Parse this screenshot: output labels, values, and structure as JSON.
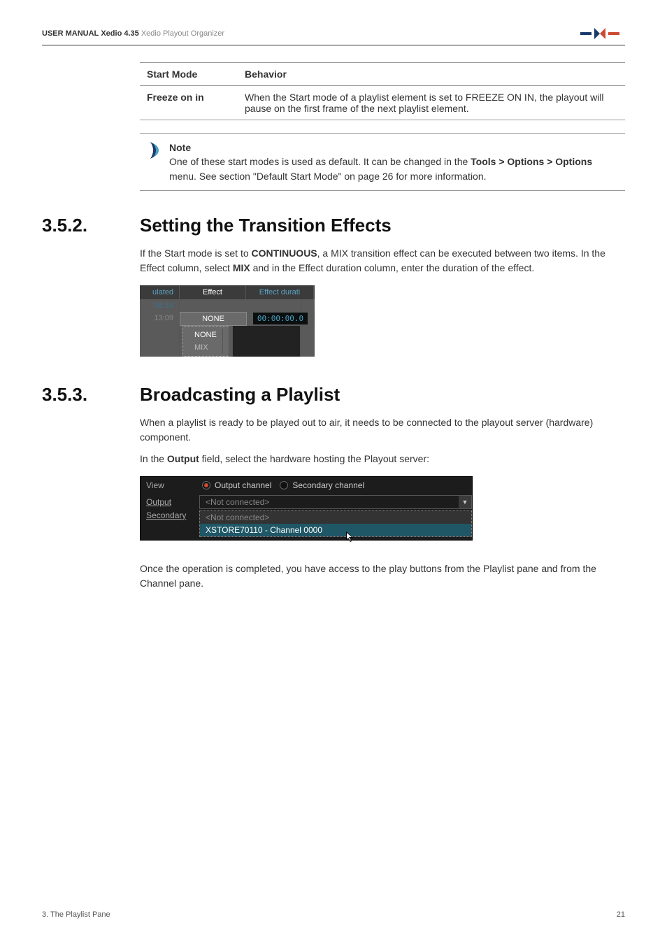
{
  "header": {
    "manual_bold": "USER MANUAL",
    "manual_rest": "Xedio 4.35",
    "product": "Xedio Playout Organizer"
  },
  "table": {
    "h1": "Start Mode",
    "h2": "Behavior",
    "r1c1": "Freeze on in",
    "r1c2": "When the Start mode of a playlist element is set to FREEZE ON IN, the playout will pause on the first frame of the next playlist element."
  },
  "note": {
    "title": "Note",
    "body_a": "One of these start modes is used as default. It can be changed in the ",
    "body_b": "Tools > Options > Options",
    "body_c": " menu. See section \"Default Start Mode\" on page 26 for more information."
  },
  "s352": {
    "num": "3.5.2.",
    "title": "Setting the Transition Effects",
    "para_a": "If the Start mode is set to ",
    "para_b": "CONTINUOUS",
    "para_c": ", a MIX transition effect can be executed between two items. In the Effect column, select ",
    "para_d": "MIX",
    "para_e": " and in the Effect duration column, enter the duration of the effect."
  },
  "effect_fig": {
    "hdr_a": "ulated",
    "hdr_b": "Effect",
    "hdr_c": "Effect durati",
    "r0a": "06:10",
    "r1a": "13:09",
    "none": "NONE",
    "none2": "NONE",
    "mix": "MIX",
    "tc": "00:00:00.0"
  },
  "s353": {
    "num": "3.5.3.",
    "title": "Broadcasting a Playlist",
    "p1": "When a playlist is ready to be played out to air, it needs to be connected to the playout server (hardware) component.",
    "p2_a": "In the ",
    "p2_b": "Output",
    "p2_c": " field, select the hardware hosting the Playout server:",
    "p3": "Once the operation is completed, you have access to the play buttons from the Playlist pane and from the Channel pane."
  },
  "output_fig": {
    "view": "View",
    "oc": "Output channel",
    "sc": "Secondary channel",
    "output": "Output",
    "secondary": "Secondary",
    "notconn": "<Not connected>",
    "notconn2": "<Not connected>",
    "xstore": "XSTORE70110 - Channel 0000"
  },
  "footer": {
    "left": "3. The Playlist Pane",
    "right": "21"
  }
}
